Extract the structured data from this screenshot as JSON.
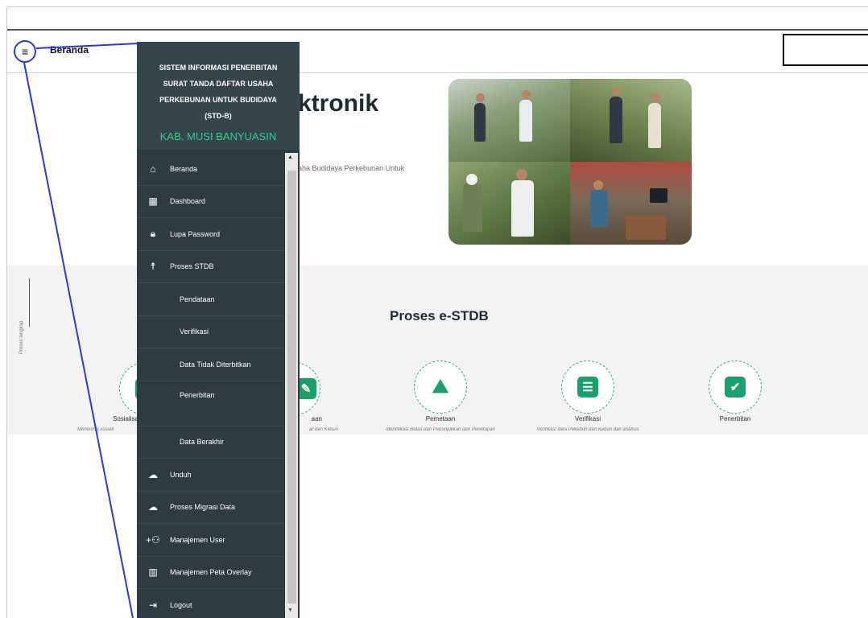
{
  "topbar": {
    "title": "Beranda",
    "hamburger_icon": "≡"
  },
  "hero": {
    "title": "ktronik",
    "subtitle": "aha Budidaya Perkebunan Untuk"
  },
  "sidebar": {
    "header_title": "SISTEM INFORMASI PENERBITAN SURAT TANDA DAFTAR USAHA PERKEBUNAN UNTUK BUDIDAYA (STD-B)",
    "title_line1": "SISTEM INFORMASI PENERBITAN",
    "title_line2": "SURAT TANDA DAFTAR USAHA",
    "title_line3": "PERKEBUNAN UNTUK BUDIDAYA",
    "title_line4": "(STD-B)",
    "region": "KAB. MUSI BANYUASIN",
    "items": [
      {
        "label": "Beranda",
        "icon": "home-icon"
      },
      {
        "label": "Dashboard",
        "icon": "dashboard-icon"
      },
      {
        "label": "Lupa Password",
        "icon": "lock-icon"
      },
      {
        "label": "Proses STDB",
        "icon": "person-icon"
      },
      {
        "label": "Pendataan",
        "icon": ""
      },
      {
        "label": "Verifikasi",
        "icon": ""
      },
      {
        "label": "Data Tidak Diterbitkan",
        "icon": ""
      },
      {
        "label": "Penerbitan",
        "icon": ""
      },
      {
        "label": "Data Berakhir",
        "icon": ""
      },
      {
        "label": "Unduh",
        "icon": "cloud-download-icon"
      },
      {
        "label": "Proses Migrasi Data",
        "icon": "cloud-upload-icon"
      },
      {
        "label": "Manajemen User",
        "icon": "add-users-icon"
      },
      {
        "label": "Manajemen Peta Overlay",
        "icon": "map-icon"
      },
      {
        "label": "Logout",
        "icon": "logout-icon"
      }
    ]
  },
  "process": {
    "title": "Proses e-STDB",
    "side_label": "Proses lengkap",
    "steps": [
      {
        "label": "Sosialisa",
        "desc": "Menerima sosiali",
        "icon": "people-icon"
      },
      {
        "label": "aan",
        "desc": "ar dan Kebun",
        "icon": "pen-icon"
      },
      {
        "label": "Pemetaan",
        "desc": "Identifikasi Batas dan Penunjukkan dan Penetapan",
        "icon": "map-pin-icon"
      },
      {
        "label": "Verifikasi",
        "desc": "Verifikasi data Pekebun dan Kebun dan analisis",
        "icon": "clipboard-list-icon"
      },
      {
        "label": "Penerbitan",
        "desc": "",
        "icon": "clipboard-check-icon"
      }
    ]
  },
  "colors": {
    "sidebar_bg": "#2d3b42",
    "accent_green": "#2fd08a",
    "annotation_blue": "#2a3ad8"
  }
}
